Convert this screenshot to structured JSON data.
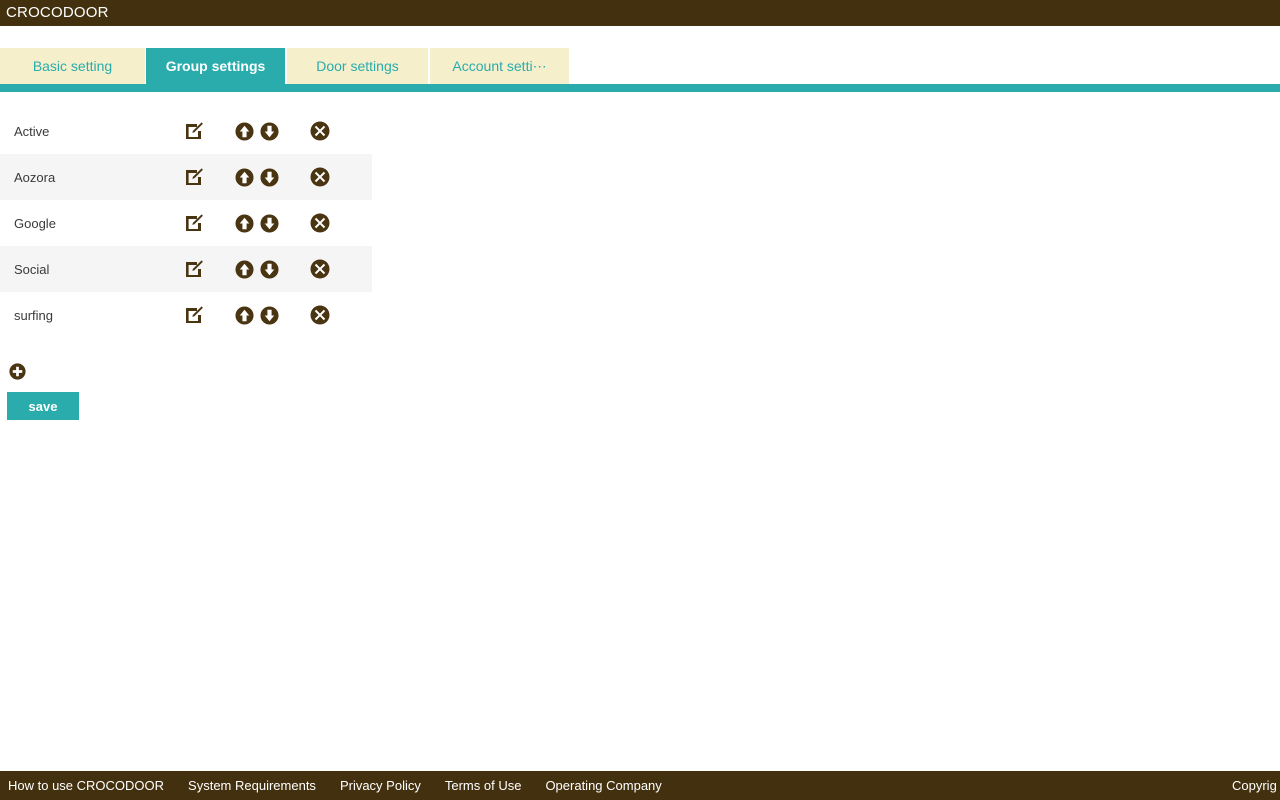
{
  "header": {
    "brand": "CROCODOOR",
    "bar_color": "#43300e",
    "text_color": "#ffffff"
  },
  "tabs": {
    "active_index": 1,
    "active_color": "#2aacac",
    "inactive_color": "#f5efcc",
    "inactive_text_color": "#2aacac",
    "items": [
      {
        "label": "Basic setting"
      },
      {
        "label": "Group settings"
      },
      {
        "label": "Door settings"
      },
      {
        "label": "Account setti⋯"
      }
    ]
  },
  "main": {
    "row_alt_color": "#f5f5f5",
    "groups": [
      {
        "name": "Active"
      },
      {
        "name": "Aozora"
      },
      {
        "name": "Google"
      },
      {
        "name": "Social"
      },
      {
        "name": "surfing"
      }
    ],
    "row_actions": {
      "edit": "edit-icon",
      "move_up": "arrow-up-circle-icon",
      "move_down": "arrow-down-circle-icon",
      "delete": "close-circle-icon"
    },
    "add_icon": "plus-circle-icon",
    "save_label": "save",
    "save_color": "#2aacac"
  },
  "footer": {
    "bar_color": "#43300e",
    "links": [
      {
        "label": "How to use CROCODOOR"
      },
      {
        "label": "System Requirements"
      },
      {
        "label": "Privacy Policy"
      },
      {
        "label": "Terms of Use"
      },
      {
        "label": "Operating Company"
      }
    ],
    "copyright": "Copyrig"
  },
  "icon_color": "#4a3512"
}
